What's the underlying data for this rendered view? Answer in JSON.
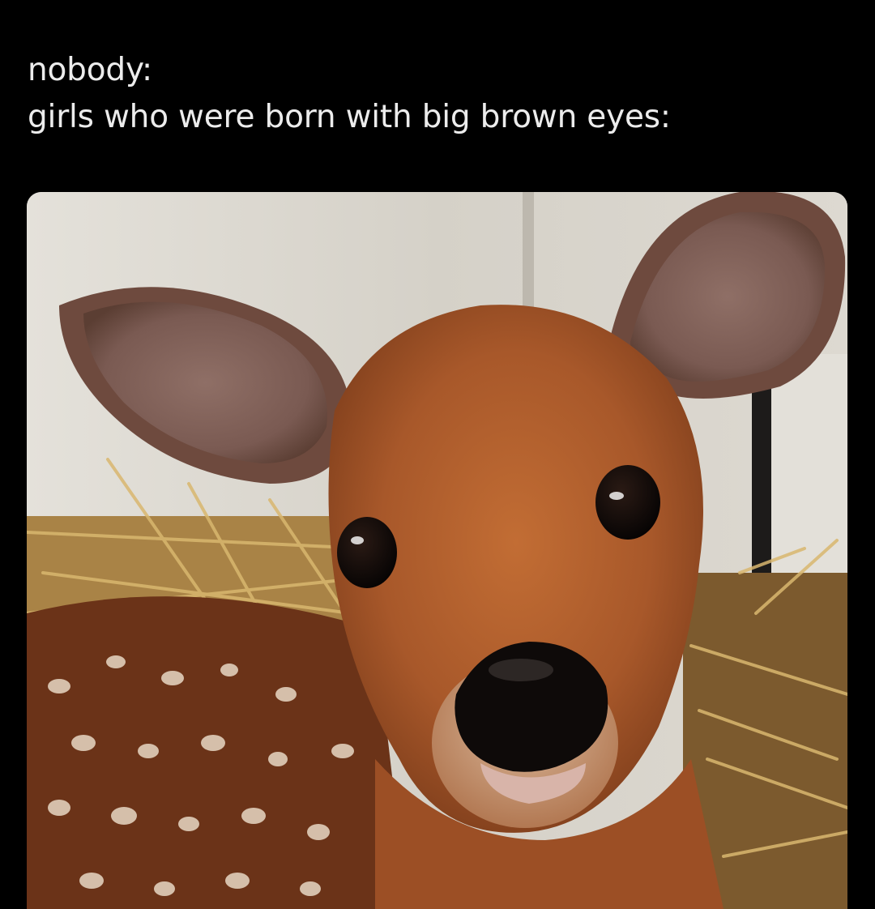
{
  "caption": {
    "line1": "nobody:",
    "line2": "girls who were born with big brown eyes:"
  },
  "photo": {
    "subject": "fawn",
    "colors": {
      "background": "#000000",
      "caption_text": "#ececec",
      "fence": "#dcd9d2",
      "straw": "#b9934f",
      "fur": "#a8582a",
      "spotted_coat": "#6b3318",
      "nose": "#0e0a09"
    }
  }
}
